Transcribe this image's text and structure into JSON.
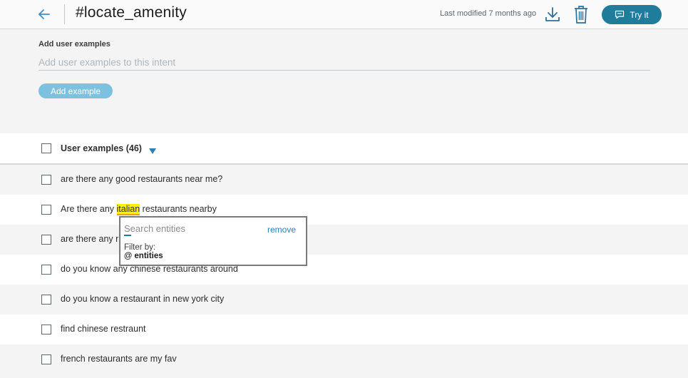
{
  "header": {
    "title": "#locate_amenity",
    "last_modified": "Last modified 7 months ago",
    "try_label": "Try it"
  },
  "add_examples": {
    "label": "Add user examples",
    "placeholder": "Add user examples to this intent",
    "button_label": "Add example"
  },
  "list": {
    "header_label": "User examples (46)",
    "rows": [
      {
        "text": "are there any good restaurants near me?"
      },
      {
        "prefix": "Are there any ",
        "highlight": "italian",
        "suffix": " restaurants nearby"
      },
      {
        "text": "are there any r"
      },
      {
        "text": "do you know any chinese restaurants around"
      },
      {
        "text": "do you know a restaurant in new york city"
      },
      {
        "text": "find chinese restraunt"
      },
      {
        "text": "french restaurants are my fav"
      }
    ]
  },
  "entity_popup": {
    "search_placeholder": "Search entities",
    "remove_label": "remove",
    "filter_label": "Filter by:",
    "filter_option": "@ entities"
  },
  "colors": {
    "accent": "#1f7c9a",
    "highlight": "#fff200",
    "add_button": "#7cc2e0"
  }
}
